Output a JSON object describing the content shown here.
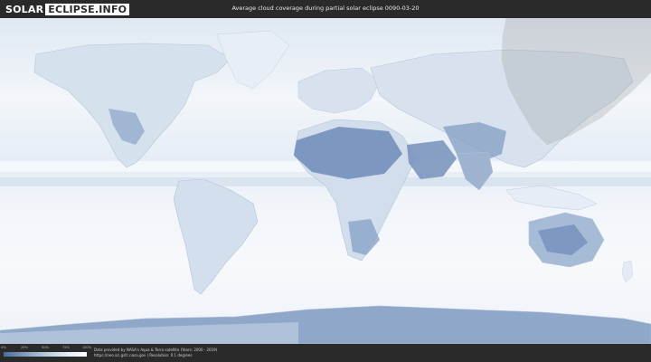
{
  "header": {
    "logo_part1": "SOLAR",
    "logo_part2": "ECLIPSE.INFO",
    "title": "Average cloud coverage during partial solar eclipse 0090-03-20"
  },
  "legend": {
    "ticks": [
      "0%",
      "25%",
      "50%",
      "75%",
      "100%"
    ],
    "colors": [
      "#4a6c9c",
      "#7f9cc0",
      "#b5c8de",
      "#e2ebf5",
      "#ffffff"
    ]
  },
  "footer": {
    "credit_line1": "Data provided by NASA's Aqua & Terra satellite (Years: 2000 - 2019)",
    "credit_line2": "https://neo.sci.gsfc.nasa.gov  |  Resolution: 0.1 degrees"
  },
  "colors": {
    "ocean_base": "#eef3f8",
    "cloud_clear": "#5f7fae",
    "eclipse_shadow": "#9a9a9a"
  }
}
